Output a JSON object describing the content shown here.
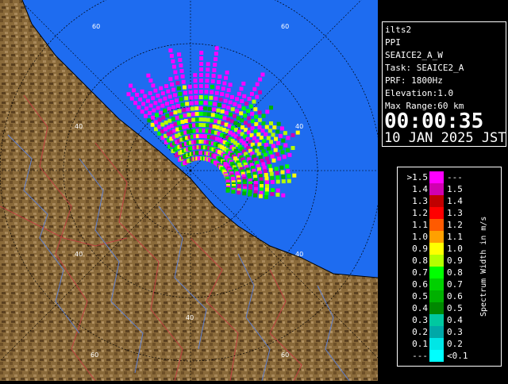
{
  "info": {
    "station": "ilts2",
    "product": "PPI",
    "scan": "SEAICE2_A_W",
    "task": "Task: SEAICE2_A",
    "prf": "PRF: 1800Hz",
    "elevation": "Elevation:1.0",
    "max_range": "Max Range:60 km",
    "time": "00:00:35",
    "date": "10 JAN 2025 JST"
  },
  "legend": {
    "title": "Spectrum Width in m/s",
    "rows": [
      {
        "lo": ">1.5",
        "hi": "---",
        "color": "#ff00ff"
      },
      {
        "lo": "1.4",
        "hi": "1.5",
        "color": "#d000b0"
      },
      {
        "lo": "1.3",
        "hi": "1.4",
        "color": "#c00000"
      },
      {
        "lo": "1.2",
        "hi": "1.3",
        "color": "#ff0000"
      },
      {
        "lo": "1.1",
        "hi": "1.2",
        "color": "#ff5a00"
      },
      {
        "lo": "1.0",
        "hi": "1.1",
        "color": "#ffa000"
      },
      {
        "lo": "0.9",
        "hi": "1.0",
        "color": "#ffff00"
      },
      {
        "lo": "0.8",
        "hi": "0.9",
        "color": "#b4ff00"
      },
      {
        "lo": "0.7",
        "hi": "0.8",
        "color": "#00ff00"
      },
      {
        "lo": "0.6",
        "hi": "0.7",
        "color": "#00d000"
      },
      {
        "lo": "0.5",
        "hi": "0.6",
        "color": "#00b000"
      },
      {
        "lo": "0.4",
        "hi": "0.5",
        "color": "#008800"
      },
      {
        "lo": "0.3",
        "hi": "0.4",
        "color": "#00c8a0"
      },
      {
        "lo": "0.2",
        "hi": "0.3",
        "color": "#00a8a8"
      },
      {
        "lo": "0.1",
        "hi": "0.2",
        "color": "#00e6e6"
      },
      {
        "lo": "---",
        "hi": "<0.1",
        "color": "#00ffff"
      }
    ]
  },
  "map": {
    "range_labels": [
      "60",
      "60",
      "40",
      "40",
      "40",
      "40",
      "60"
    ],
    "sea_color": "#1e6cf0",
    "land_color": "#8a6a3a"
  }
}
